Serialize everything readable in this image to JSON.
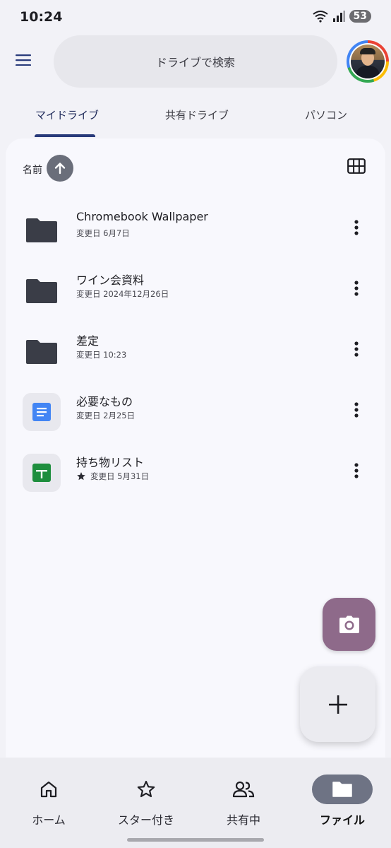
{
  "status_bar": {
    "time": "10:24",
    "battery": "53"
  },
  "header": {
    "search_placeholder": "ドライブで検索"
  },
  "tabs": [
    {
      "label": "マイドライブ",
      "active": true
    },
    {
      "label": "共有ドライブ",
      "active": false
    },
    {
      "label": "パソコン",
      "active": false
    }
  ],
  "sort": {
    "label": "名前"
  },
  "files": [
    {
      "name": "Chromebook Wallpaper",
      "meta": "変更日 6月7日",
      "type": "folder",
      "starred": false
    },
    {
      "name": "ワイン会資料",
      "meta": "変更日 2024年12月26日",
      "type": "folder",
      "starred": false
    },
    {
      "name": "差定",
      "meta": "変更日 10:23",
      "type": "folder",
      "starred": false
    },
    {
      "name": "必要なもの",
      "meta": "変更日 2月25日",
      "type": "doc",
      "starred": false
    },
    {
      "name": "持ち物リスト",
      "meta": "変更日 5月31日",
      "type": "sheet",
      "starred": true
    }
  ],
  "bottom_nav": [
    {
      "label": "ホーム",
      "icon": "home-icon",
      "active": false
    },
    {
      "label": "スター付き",
      "icon": "star-icon",
      "active": false
    },
    {
      "label": "共有中",
      "icon": "people-icon",
      "active": false
    },
    {
      "label": "ファイル",
      "icon": "folder-icon",
      "active": true
    }
  ],
  "colors": {
    "accent": "#283a7a",
    "camera_fab": "#8e6a8a",
    "doc_blue": "#4285f4",
    "sheet_green": "#1e8e3e",
    "folder": "#3a3d47"
  }
}
